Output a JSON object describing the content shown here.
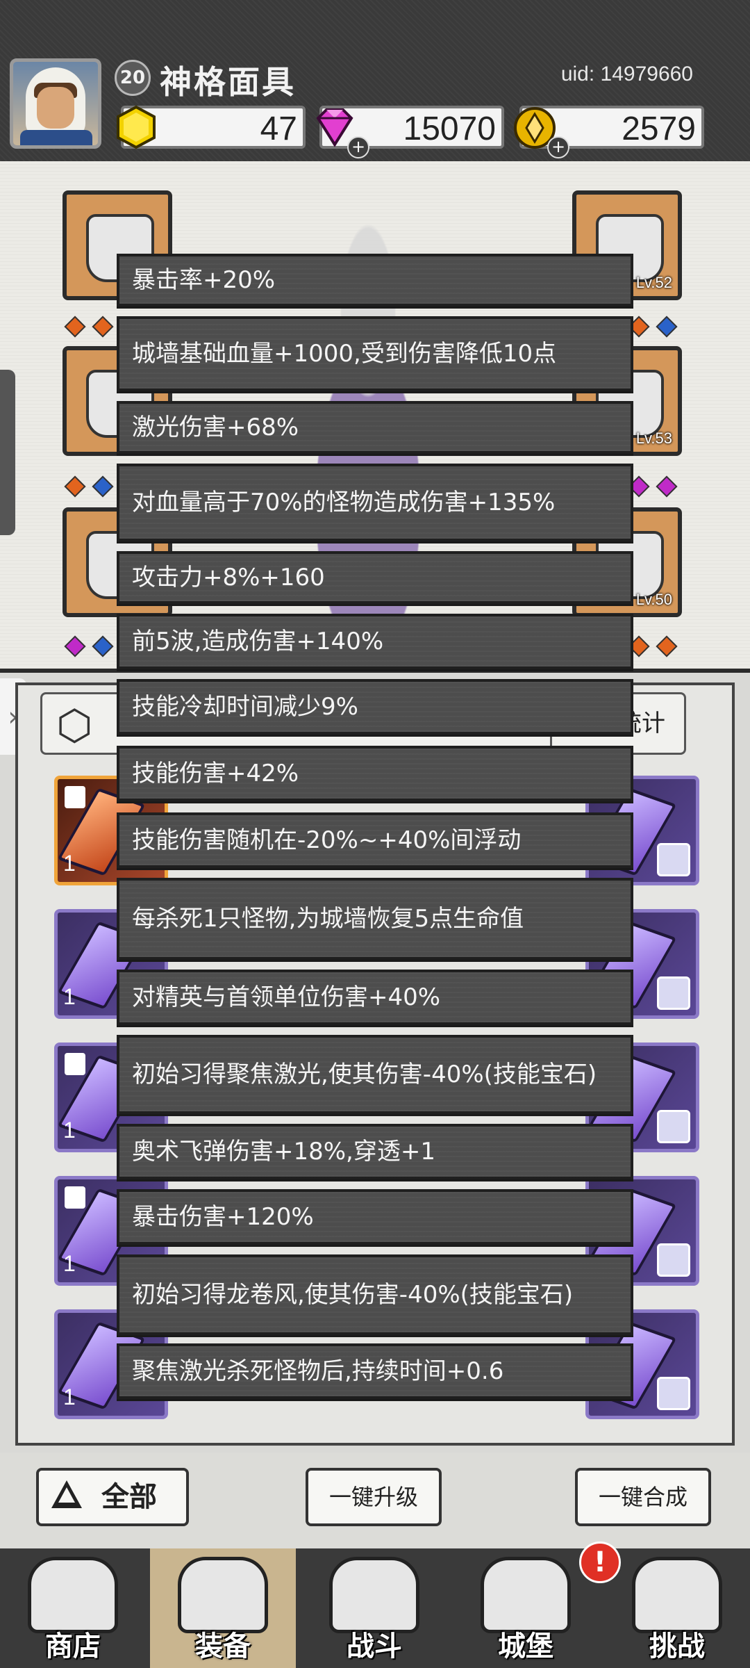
{
  "player": {
    "level": "20",
    "name": "神格面具",
    "uid": "uid: 14979660"
  },
  "resources": {
    "gold": "47",
    "gems": "15070",
    "coins": "2579"
  },
  "equipment": {
    "right_slots": [
      {
        "level": "Lv.52"
      },
      {
        "level": "Lv.53"
      },
      {
        "level": "Lv.50"
      }
    ]
  },
  "inventory": {
    "stats_button": "属性统计",
    "card_quantity": "1"
  },
  "tooltips": [
    "暴击率+20%",
    "城墙基础血量+1000,受到伤害降低10点",
    "激光伤害+68%",
    "对血量高于70%的怪物造成伤害+135%",
    "攻击力+8%+160",
    "前5波,造成伤害+140%",
    "技能冷却时间减少9%",
    "技能伤害+42%",
    "技能伤害随机在-20%~+40%间浮动",
    "每杀死1只怪物,为城墙恢复5点生命值",
    "对精英与首领单位伤害+40%",
    "初始习得聚焦激光,使其伤害-40%(技能宝石)",
    "奥术飞弹伤害+18%,穿透+1",
    "暴击伤害+120%",
    "初始习得龙卷风,使其伤害-40%(技能宝石)",
    "聚焦激光杀死怪物后,持续时间+0.6"
  ],
  "buttons": {
    "all": "全部",
    "one_click_upgrade": "一键升级",
    "one_click_merge": "一键合成"
  },
  "nav": {
    "shop": "商店",
    "equipment": "装备",
    "battle": "战斗",
    "castle": "城堡",
    "challenge": "挑战",
    "alert": "!"
  },
  "colors": {
    "tooltip_bg": "#4d4d4d",
    "card_purple": "#8b79c7",
    "card_orange": "#f0a43a",
    "active_nav": "#c9b58f"
  }
}
